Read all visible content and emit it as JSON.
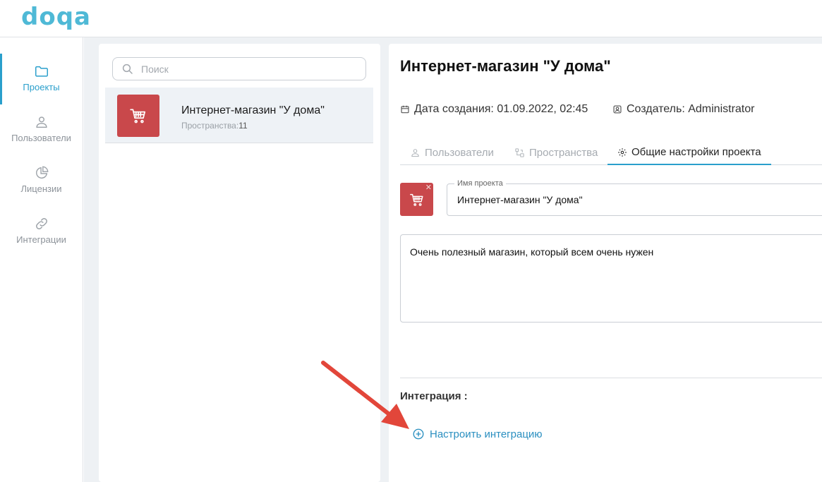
{
  "app": {
    "logo_text": "doqa",
    "brand_color": "#4fb9d6",
    "accent_color": "#2a9fcc",
    "project_color": "#c9484b"
  },
  "sidebar": {
    "items": [
      {
        "label": "Проекты",
        "icon": "folder-icon",
        "active": true
      },
      {
        "label": "Пользователи",
        "icon": "user-icon",
        "active": false
      },
      {
        "label": "Лицензии",
        "icon": "pie-chart-icon",
        "active": false
      },
      {
        "label": "Интеграции",
        "icon": "link-icon",
        "active": false
      }
    ]
  },
  "projects_list": {
    "search_placeholder": "Поиск",
    "items": [
      {
        "name": "Интернет-магазин \"У дома\"",
        "spaces_label": "Пространства:",
        "spaces_count": "11",
        "icon": "cart-icon"
      }
    ]
  },
  "project": {
    "title": "Интернет-магазин \"У дома\"",
    "created": "Дата создания: 01.09.2022, 02:45",
    "creator": "Создатель: Administrator",
    "tabs": [
      {
        "label": "Пользователи",
        "icon": "user-icon",
        "active": false
      },
      {
        "label": "Пространства",
        "icon": "spaces-icon",
        "active": false
      },
      {
        "label": "Общие настройки проекта",
        "icon": "gear-icon",
        "active": true
      }
    ],
    "name_field_label": "Имя проекта",
    "name_value": "Интернет-магазин \"У дома\"",
    "description": "Очень полезный магазин, который всем очень нужен",
    "integration_title": "Интеграция :",
    "integration_button": "Настроить интеграцию",
    "image_remove_glyph": "✕"
  }
}
